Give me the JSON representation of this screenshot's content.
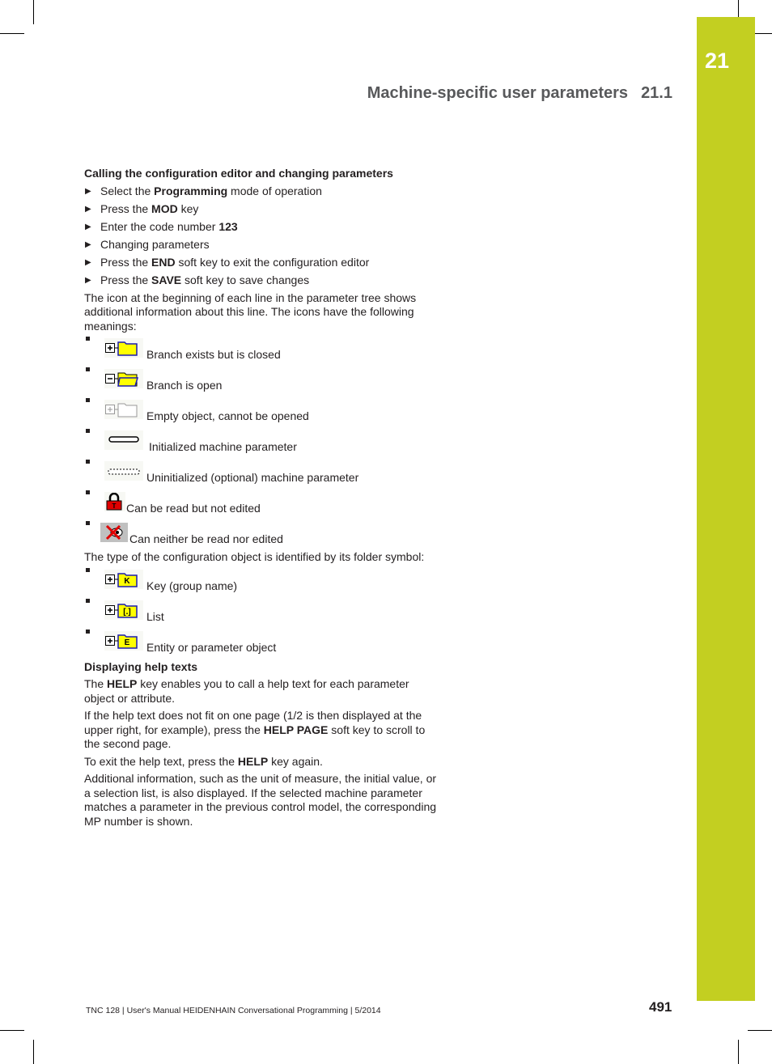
{
  "chapter_tab": {
    "number": "21",
    "color": "#c3cf21"
  },
  "header": {
    "title": "Machine-specific user parameters",
    "section": "21.1"
  },
  "section1": {
    "heading": "Calling the configuration editor and changing parameters",
    "steps": [
      {
        "pre": "Select the ",
        "bold": "Programming",
        "post": " mode of operation"
      },
      {
        "pre": "Press the ",
        "bold": "MOD",
        "post": " key"
      },
      {
        "pre": "Enter the code number ",
        "bold": "123",
        "post": ""
      },
      {
        "pre": "Changing parameters",
        "bold": "",
        "post": ""
      },
      {
        "pre": "Press the ",
        "bold": "END",
        "post": " soft key to exit the configuration editor"
      },
      {
        "pre": "Press the ",
        "bold": "SAVE",
        "post": " soft key to save changes"
      }
    ],
    "intro": "The icon at the beginning of each line in the parameter tree shows additional information about this line. The icons have the following meanings:",
    "icons": [
      {
        "icon": "folder-closed-plus-icon",
        "label": "Branch exists but is closed"
      },
      {
        "icon": "folder-open-minus-icon",
        "label": "Branch is open"
      },
      {
        "icon": "folder-empty-icon",
        "label": "Empty object, cannot be opened"
      },
      {
        "icon": "initialized-parameter-icon",
        "label": "Initialized machine parameter"
      },
      {
        "icon": "uninitialized-parameter-icon",
        "label": "Uninitialized (optional) machine parameter"
      },
      {
        "icon": "padlock-icon",
        "label": "Can be read but not edited"
      },
      {
        "icon": "crossed-eye-icon",
        "label": "Can neither be read nor edited"
      }
    ],
    "type_intro": "The type of the configuration object is identified by its folder symbol:",
    "types": [
      {
        "icon": "folder-key-icon",
        "letter": "K",
        "label": "Key (group name)"
      },
      {
        "icon": "folder-list-icon",
        "letter": "[.]",
        "label": "List"
      },
      {
        "icon": "folder-entity-icon",
        "letter": "E",
        "label": "Entity or parameter object"
      }
    ]
  },
  "section2": {
    "heading": "Displaying help texts",
    "p1": {
      "pre": "The ",
      "bold": "HELP",
      "post": " key enables you to call a help text for each parameter object or attribute."
    },
    "p2": {
      "pre": "If the help text does not fit on one page (1/2 is then displayed at the upper right, for example), press the ",
      "bold": "HELP PAGE",
      "post": " soft key to scroll to the second page."
    },
    "p3": {
      "pre": "To exit the help text, press the ",
      "bold": "HELP",
      "post": " key again."
    },
    "p4": "Additional information, such as the unit of measure, the initial value, or a selection list, is also displayed. If the selected machine parameter matches a parameter in the previous control model, the corresponding MP number is shown."
  },
  "footer": {
    "text": "TNC 128 | User's Manual HEIDENHAIN Conversational Programming | 5/2014",
    "page": "491"
  }
}
